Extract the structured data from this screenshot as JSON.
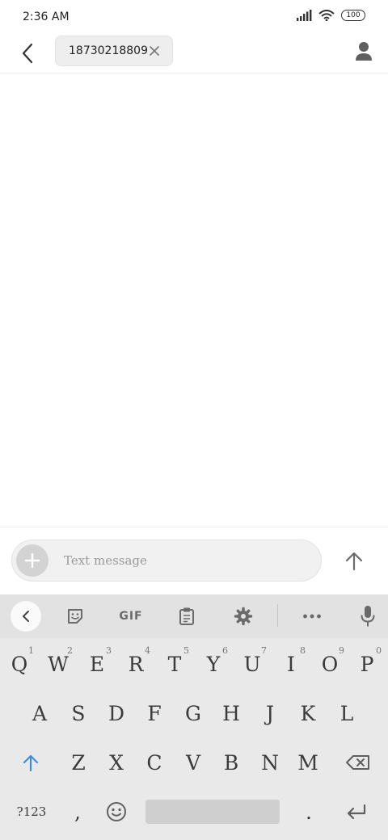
{
  "status_bar": {
    "time": "2:36 AM",
    "battery": "100",
    "icons": [
      "signal-icon",
      "wifi-icon",
      "battery-icon"
    ]
  },
  "header": {
    "back_icon": "chevron-left-icon",
    "recipient": "18730218809",
    "remove_icon": "close-icon",
    "contact_icon": "person-icon"
  },
  "composer": {
    "placeholder": "Text message",
    "attach_icon": "plus-icon",
    "send_icon": "arrow-up-icon"
  },
  "keyboard": {
    "toolbar": {
      "collapse_icon": "chevron-left-icon",
      "sticker_icon": "sticker-icon",
      "gif_label": "GIF",
      "clipboard_icon": "clipboard-icon",
      "settings_icon": "gear-icon",
      "more_icon": "more-dots-icon",
      "mic_icon": "microphone-icon"
    },
    "row1": [
      {
        "label": "Q",
        "hint": "1"
      },
      {
        "label": "W",
        "hint": "2"
      },
      {
        "label": "E",
        "hint": "3"
      },
      {
        "label": "R",
        "hint": "4"
      },
      {
        "label": "T",
        "hint": "5"
      },
      {
        "label": "Y",
        "hint": "6"
      },
      {
        "label": "U",
        "hint": "7"
      },
      {
        "label": "I",
        "hint": "8"
      },
      {
        "label": "O",
        "hint": "9"
      },
      {
        "label": "P",
        "hint": "0"
      }
    ],
    "row2": [
      "A",
      "S",
      "D",
      "F",
      "G",
      "H",
      "J",
      "K",
      "L"
    ],
    "row3": [
      "Z",
      "X",
      "C",
      "V",
      "B",
      "N",
      "M"
    ],
    "symbols_label": "?123",
    "comma": ",",
    "period": ".",
    "shift_icon": "shift-arrow-icon",
    "backspace_icon": "backspace-icon",
    "emoji_icon": "emoji-icon",
    "enter_icon": "enter-icon",
    "accent_color": "#3d8fd8"
  }
}
